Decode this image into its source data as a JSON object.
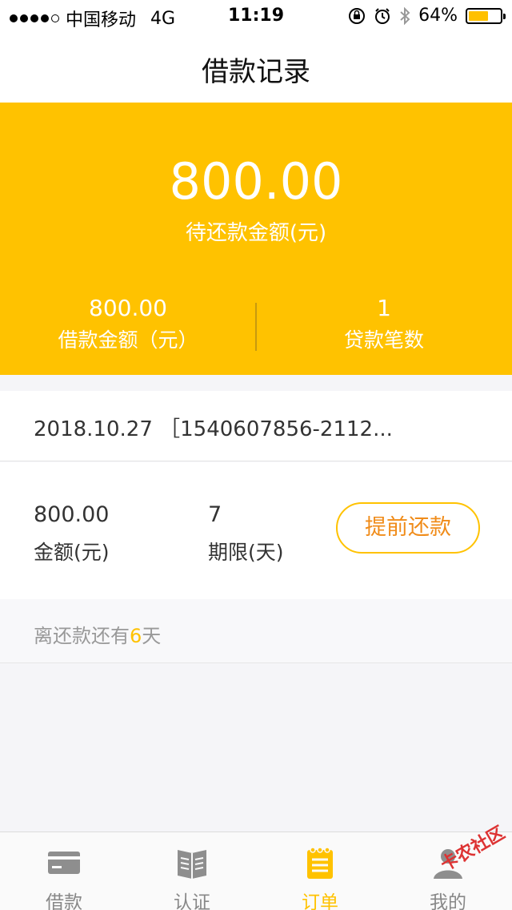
{
  "status_bar": {
    "carrier": "中国移动",
    "network": "4G",
    "time": "11:19",
    "battery": "64%",
    "battery_level": 0.64
  },
  "nav": {
    "title": "借款记录"
  },
  "summary": {
    "pending_amount": "800.00",
    "pending_label": "待还款金额(元)",
    "loan_amount": "800.00",
    "loan_amount_label": "借款金额（元）",
    "loan_count": "1",
    "loan_count_label": "贷款笔数"
  },
  "record": {
    "header": "2018.10.27 ［1540607856-2112...",
    "amount": "800.00",
    "amount_label": "金额(元)",
    "term": "7",
    "term_label": "期限(天)",
    "repay_button": "提前还款",
    "due_prefix": "离还款还有",
    "due_days": "6",
    "due_suffix": "天"
  },
  "tabs": [
    {
      "label": "借款",
      "icon": "card-icon"
    },
    {
      "label": "认证",
      "icon": "book-icon"
    },
    {
      "label": "订单",
      "icon": "notepad-icon"
    },
    {
      "label": "我的",
      "icon": "user-icon"
    }
  ],
  "watermark": "卡农社区",
  "colors": {
    "accent": "#ffc200",
    "button_text": "#f08c1a"
  }
}
